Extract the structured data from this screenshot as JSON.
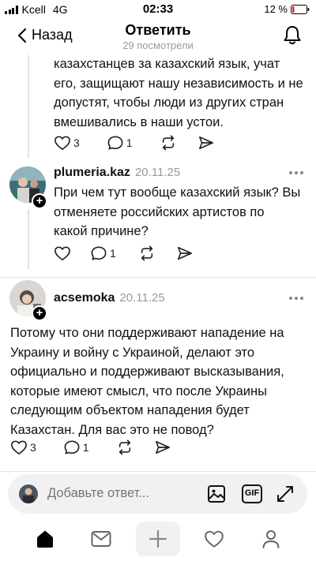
{
  "status_bar": {
    "carrier": "Kcell",
    "network": "4G",
    "time": "02:33",
    "battery": "12 %"
  },
  "nav": {
    "back_label": "Назад",
    "title": "Ответить",
    "subtitle": "29 посмотрели"
  },
  "comment_top": {
    "lines": [
      "казахстанцев за казахский язык, учат",
      "его, защищают нашу независимость и не",
      "допустят, чтобы люди из других стран",
      "вмешивались в наши устои."
    ],
    "likes": "3",
    "replies": "1"
  },
  "comment_plumeria": {
    "username": "plumeria.kaz",
    "date": "20.11.25",
    "lines": [
      "При чем тут вообще казахский язык? Вы",
      "отменяете российских артистов по",
      "какой причине?"
    ],
    "replies": "1"
  },
  "comment_acsemoka": {
    "username": "acsemoka",
    "date": "20.11.25",
    "lines": [
      "Потому что они поддерживают нападение на",
      "Украину и  войну с Украиной, делают это",
      "официально и поддерживают высказывания,",
      "которые имеют смысл, что после Украины",
      "следующим объектом нападения будет",
      "Казахстан. Для вас это не повод?"
    ],
    "likes": "3",
    "replies": "1"
  },
  "reply_bar": {
    "placeholder": "Добавьте ответ...",
    "gif_label": "GIF"
  },
  "tab_bar": {
    "items": [
      "home",
      "inbox",
      "create",
      "activity",
      "profile"
    ]
  },
  "colors": {
    "accent": "#000000",
    "muted": "#999999",
    "divider": "#e6e6e6",
    "input_bg": "#f1f1f1"
  }
}
